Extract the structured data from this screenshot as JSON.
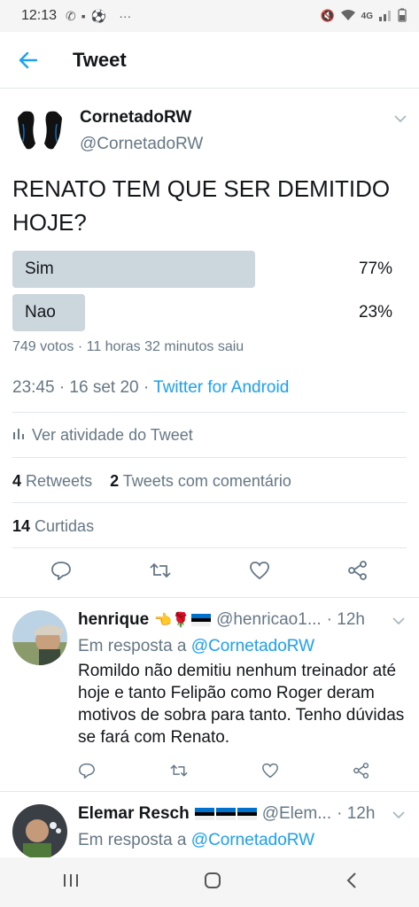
{
  "status_bar": {
    "time": "12:13",
    "dots": "···",
    "network": "4G"
  },
  "header": {
    "title": "Tweet"
  },
  "tweet": {
    "author_name": "CornetadoRW",
    "author_handle": "@CornetadoRW",
    "text": "RENATO TEM QUE SER DEMITIDO HOJE?",
    "poll": {
      "options": [
        {
          "label": "Sim",
          "percent_text": "77%",
          "percent": 77
        },
        {
          "label": "Nao",
          "percent_text": "23%",
          "percent": 23
        }
      ],
      "meta": "749 votos · 11 horas 32 minutos saiu"
    },
    "timestamp": "23:45 · 16 set 20 · ",
    "source": "Twitter for Android",
    "activity_label": "Ver atividade do Tweet",
    "retweets_count": "4",
    "retweets_label": "Retweets",
    "quotes_count": "2",
    "quotes_label": "Tweets com comentário",
    "likes_count": "14",
    "likes_label": "Curtidas"
  },
  "replies": [
    {
      "name": "henrique",
      "emoji": "👈🌹",
      "handle": "@henricao1...",
      "time": "· 12h",
      "reply_prefix": "Em resposta a ",
      "reply_to": "@CornetadoRW",
      "text": "Romildo não demitiu nenhum treinador até hoje e tanto Felipão como Roger deram motivos de sobra para tanto. Tenho dúvidas se fará com Renato."
    },
    {
      "name": "Elemar Resch",
      "handle": "@Elem...",
      "time": "· 12h",
      "reply_prefix": "Em resposta a ",
      "reply_to": "@CornetadoRW"
    }
  ],
  "colors": {
    "accent": "#1da1f2",
    "muted": "#657786",
    "poll_bar": "#ccd6dd",
    "divider": "#e1e8ed"
  }
}
